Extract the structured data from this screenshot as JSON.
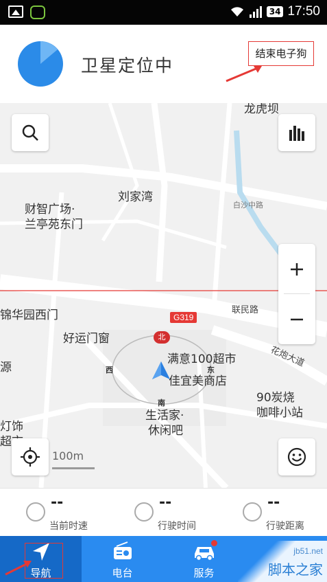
{
  "status_bar": {
    "battery": "34",
    "time": "17:50"
  },
  "header": {
    "title": "卫星定位中",
    "end_button": "结束电子狗"
  },
  "map": {
    "labels": {
      "longhuba": "龙虎坝",
      "liujiawan": "刘家湾",
      "caizhi": "财智广场·",
      "lanting": "兰亭苑东门",
      "jinhua": "锦华园西门",
      "haoyun": "好运门窗",
      "manyi": "满意100超市",
      "jiayimei": "佳宜美商店",
      "shenghuojia": "生活家·",
      "xiuxianba": "休闲吧",
      "tan90": "90炭烧",
      "kafei": "咖啡小站",
      "yuan": "源",
      "dengshi": "灯饰",
      "chaoshi": "超市"
    },
    "roads": {
      "minlu": "联民路",
      "huapao": "花炮大道",
      "baisha": "白沙中路"
    },
    "highway": "G319",
    "compass_north": "北",
    "compass_east": "东",
    "compass_south": "南",
    "compass_west": "西",
    "scale": "100m"
  },
  "stats": [
    {
      "value": "--",
      "label": "当前时速",
      "icon": "speedometer-icon"
    },
    {
      "value": "--",
      "label": "行驶时间",
      "icon": "stopwatch-icon"
    },
    {
      "value": "--",
      "label": "行驶距离",
      "icon": "distance-icon"
    }
  ],
  "tabs": [
    {
      "label": "导航",
      "icon": "navigation-arrow-icon",
      "active": true
    },
    {
      "label": "电台",
      "icon": "radio-icon",
      "active": false
    },
    {
      "label": "服务",
      "icon": "car-icon",
      "active": false
    },
    {
      "label": "",
      "icon": "",
      "active": false
    }
  ],
  "watermark": {
    "url": "jb51.net",
    "name": "脚本之家"
  },
  "colors": {
    "accent": "#2a8bf0",
    "active_tab": "#1569c7",
    "annotation": "#e53935"
  }
}
